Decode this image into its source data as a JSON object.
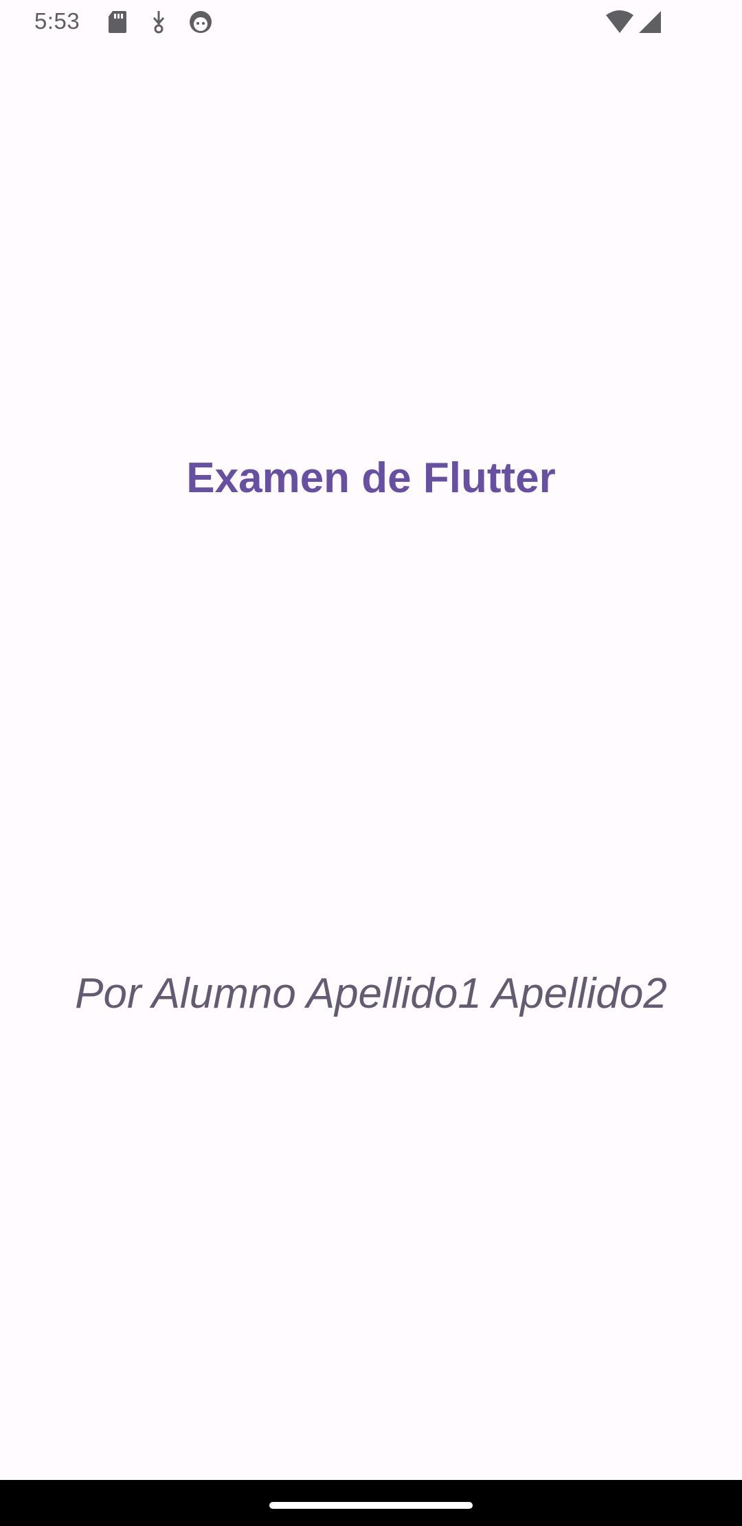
{
  "status_bar": {
    "time": "5:53",
    "icons": [
      "sd-card-icon",
      "usb-debug-icon",
      "android-face-icon",
      "wifi-icon",
      "cell-signal-icon"
    ]
  },
  "main": {
    "title": "Examen de Flutter",
    "subtitle": "Por Alumno Apellido1 Apellido2"
  },
  "colors": {
    "background": "#fffbfe",
    "title": "#6750a4",
    "subtitle": "#625b71",
    "nav_bar": "#000000"
  }
}
